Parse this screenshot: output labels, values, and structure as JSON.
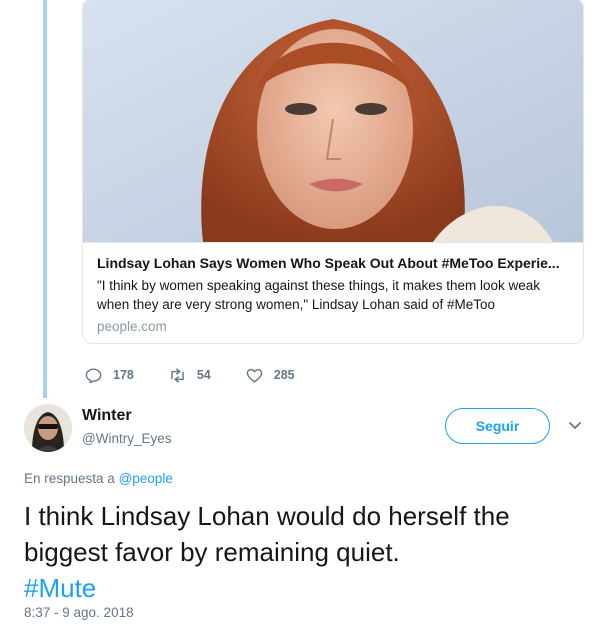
{
  "card": {
    "title": "Lindsay Lohan Says Women Who Speak Out About #MeToo Experie...",
    "description": "\"I think by women speaking against these things, it makes them look weak when they are very strong women,\" Lindsay Lohan said of #MeToo",
    "domain": "people.com",
    "image_icon": "portrait-photo"
  },
  "previous_tweet_actions": {
    "reply_count": "178",
    "retweet_count": "54",
    "like_count": "285"
  },
  "author": {
    "display_name": "Winter",
    "handle": "@Wintry_Eyes"
  },
  "follow_label": "Seguir",
  "reply_to": {
    "prefix": "En respuesta a",
    "mention": "@people"
  },
  "tweet": {
    "text": "I think Lindsay Lohan would do herself the biggest favor by remaining quiet.",
    "hashtag": "#Mute",
    "timestamp": "8:37 - 9 ago. 2018"
  },
  "colors": {
    "accent": "#1da1f2",
    "thread_line": "#a6d2f1",
    "muted": "#657786"
  }
}
